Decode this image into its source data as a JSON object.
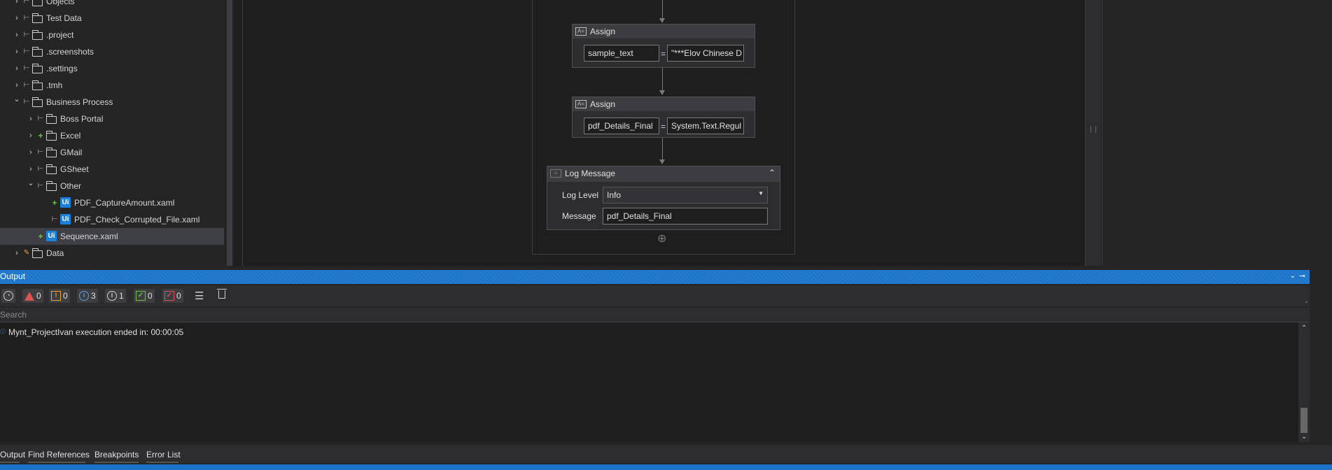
{
  "tree": {
    "items": [
      {
        "label": "Objects",
        "chevron": ">",
        "status": "|-",
        "kind": "objects"
      },
      {
        "label": "Test Data",
        "chevron": ">",
        "status": "|-",
        "kind": "testdata"
      },
      {
        "label": ".project",
        "chevron": ">",
        "status": "|-",
        "kind": "folder"
      },
      {
        "label": ".screenshots",
        "chevron": ">",
        "status": "|-",
        "kind": "folder"
      },
      {
        "label": ".settings",
        "chevron": ">",
        "status": "|-",
        "kind": "folder"
      },
      {
        "label": ".tmh",
        "chevron": ">",
        "status": "|-",
        "kind": "folder"
      },
      {
        "label": "Business Process",
        "chevron": "v",
        "status": "|-",
        "kind": "folder"
      },
      {
        "label": "Boss Portal",
        "chevron": ">",
        "status": "|-",
        "kind": "folder"
      },
      {
        "label": "Excel",
        "chevron": ">",
        "status": "+",
        "kind": "folder"
      },
      {
        "label": "GMail",
        "chevron": ">",
        "status": "|-",
        "kind": "folder"
      },
      {
        "label": "GSheet",
        "chevron": ">",
        "status": "|-",
        "kind": "folder"
      },
      {
        "label": "Other",
        "chevron": "v",
        "status": "|-",
        "kind": "folder"
      },
      {
        "label": "PDF_CaptureAmount.xaml",
        "chevron": "",
        "status": "+",
        "kind": "ui"
      },
      {
        "label": "PDF_Check_Corrupted_File.xaml",
        "chevron": "",
        "status": "|-",
        "kind": "ui"
      },
      {
        "label": "Sequence.xaml",
        "chevron": "",
        "status": "+",
        "kind": "ui"
      },
      {
        "label": "Data",
        "chevron": ">",
        "status": "✎",
        "kind": "folder"
      }
    ],
    "ui_badge": "Ui"
  },
  "designer": {
    "assign1": {
      "title": "Assign",
      "to": "sample_text",
      "eq": "=",
      "value": "\"***Elov Chinese D"
    },
    "assign2": {
      "title": "Assign",
      "to": "pdf_Details_Final",
      "eq": "=",
      "value": "System.Text.Regul"
    },
    "log": {
      "title": "Log Message",
      "level_label": "Log Level",
      "level_value": "Info",
      "message_label": "Message",
      "message_value": "pdf_Details_Final"
    },
    "add_symbol": "⊕"
  },
  "output": {
    "title": "Output",
    "filters": {
      "errors": "0",
      "warnings": "0",
      "info": "3",
      "trace": "1",
      "success": "0",
      "failed": "0"
    },
    "search_placeholder": "Search",
    "messages": [
      {
        "text": "Mynt_ProjectIvan execution ended in: 00:00:05"
      }
    ]
  },
  "bottom_tabs": [
    "Output",
    "Find References",
    "Breakpoints",
    "Error List"
  ],
  "colors": {
    "accent": "#1a73c9",
    "ui_badge": "#1e7fd6",
    "added": "#6cc04a",
    "error": "#d9534f",
    "warning": "#e8a33d"
  }
}
